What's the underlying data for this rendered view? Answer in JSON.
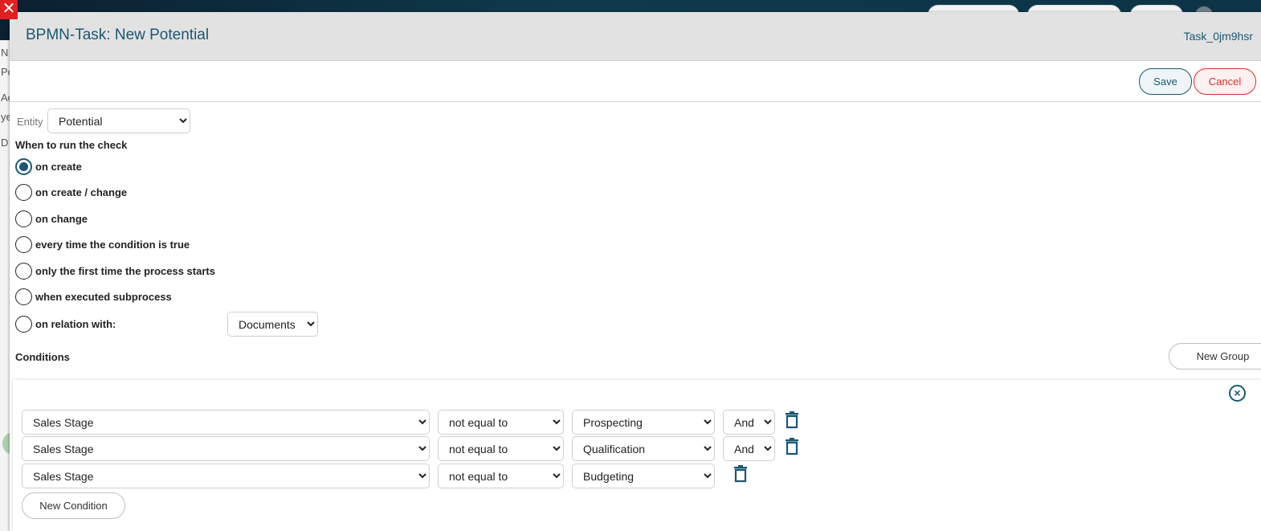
{
  "modal": {
    "title": "BPMN-Task: New Potential",
    "task_id": "Task_0jm9hsr",
    "close_glyph": "✕"
  },
  "background": {
    "side_labels": [
      "N",
      "Po",
      "Ac",
      "ye",
      "D"
    ]
  },
  "actions": {
    "save_label": "Save",
    "cancel_label": "Cancel"
  },
  "entity": {
    "label": "Entity",
    "selected": "Potential"
  },
  "when": {
    "heading": "When to run the check",
    "options": [
      {
        "label": "on create",
        "checked": true
      },
      {
        "label": "on create / change",
        "checked": false
      },
      {
        "label": "on change",
        "checked": false
      },
      {
        "label": "every time the condition is true",
        "checked": false
      },
      {
        "label": "only the first time the process starts",
        "checked": false
      },
      {
        "label": "when executed subprocess",
        "checked": false
      },
      {
        "label": "on relation with:",
        "checked": false
      }
    ],
    "relation_selected": "Documents"
  },
  "conditions": {
    "heading": "Conditions",
    "new_group_label": "New Group",
    "new_condition_label": "New Condition",
    "rows": [
      {
        "field": "Sales Stage",
        "operator": "not equal to",
        "value": "Prospecting",
        "logic": "And"
      },
      {
        "field": "Sales Stage",
        "operator": "not equal to",
        "value": "Qualification",
        "logic": "And"
      },
      {
        "field": "Sales Stage",
        "operator": "not equal to",
        "value": "Budgeting",
        "logic": null
      }
    ]
  },
  "colors": {
    "accent": "#1a5873",
    "danger": "#d9302b"
  },
  "icons": {
    "close": "close-icon",
    "remove_group": "circle-x-icon",
    "delete_row": "trash-icon"
  }
}
